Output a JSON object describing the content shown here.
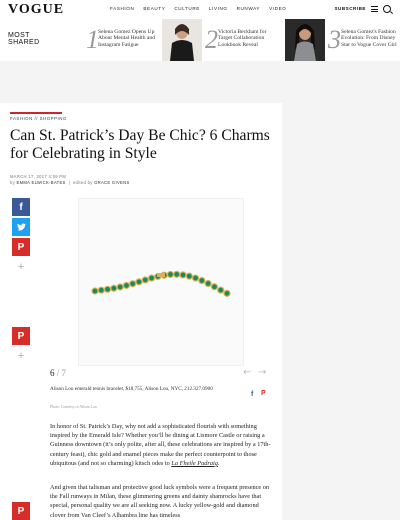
{
  "nav": {
    "logo": "VOGUE",
    "items": [
      "FASHION",
      "BEAUTY",
      "CULTURE",
      "LIVING",
      "RUNWAY",
      "VIDEO"
    ],
    "subscribe": "SUBSCRIBE"
  },
  "most_shared": {
    "label_line1": "MOST",
    "label_line2": "SHARED",
    "items": [
      {
        "num": "1",
        "title": "Selena Gomez Opens Up About Mental Health and Instagram Fatigue"
      },
      {
        "num": "2",
        "title": "Victoria Beckham for Target Collaboration Lookbook Reveal"
      },
      {
        "num": "3",
        "title": "Selena Gomez's Fashion Evolution: From Disney Star to Vogue Cover Girl"
      }
    ]
  },
  "article": {
    "kicker": "FASHION // SHOPPING",
    "headline": "Can St. Patrick’s Day Be Chic? 6 Charms for Celebrating in Style",
    "date": "MARCH 17, 2017 4:59 PM",
    "byline_prefix": "by",
    "author": "EMMA ELWICK-BATES",
    "edited_prefix": "edited by",
    "editor": "GRACE GIVENS",
    "gallery_current": "6",
    "gallery_total": "/ 7",
    "caption": "Alison Lou emerald tennis bracelet, $18,755, Alison Lou, NYC, 212.327.0900",
    "credit": "Photo: Courtesy of Alison Lou",
    "p1_a": "In honor of St. Patrick’s Day, why not add a sophisticated flourish with something inspired by the Emerald Isle? Whether you’ll be dining at Lismore Castle or raising a Guinness downtown (it’s only polite, after all, these celebrations are inspired by a 17th-century feast), chic gold and enamel pieces make the perfect counterpoint to those ubiquitous (and not so charming) kitsch odes to ",
    "p1_italic": "La Fheile Padraig",
    "p1_end": ".",
    "p2": "And given that talisman and protective good luck symbols were a frequent presence on the Fall runways in Milan, these glimmering greens and dainty shamrocks have that special, personal quality we are all seeking now. A lucky yellow-gold and diamond clover from Van Cleef’s Alhambra line has timeless"
  },
  "colors": {
    "facebook": "#3b5998",
    "twitter": "#1da1f2",
    "pinterest": "#d62d2a",
    "accent_rule": "#c8272e",
    "emerald": "#1e8a5a",
    "gold": "#d9b35a"
  },
  "icons": [
    "facebook-icon",
    "twitter-icon",
    "pinterest-icon",
    "plus-icon",
    "search-icon",
    "menu-icon",
    "arrow-left-icon",
    "arrow-right-icon"
  ]
}
